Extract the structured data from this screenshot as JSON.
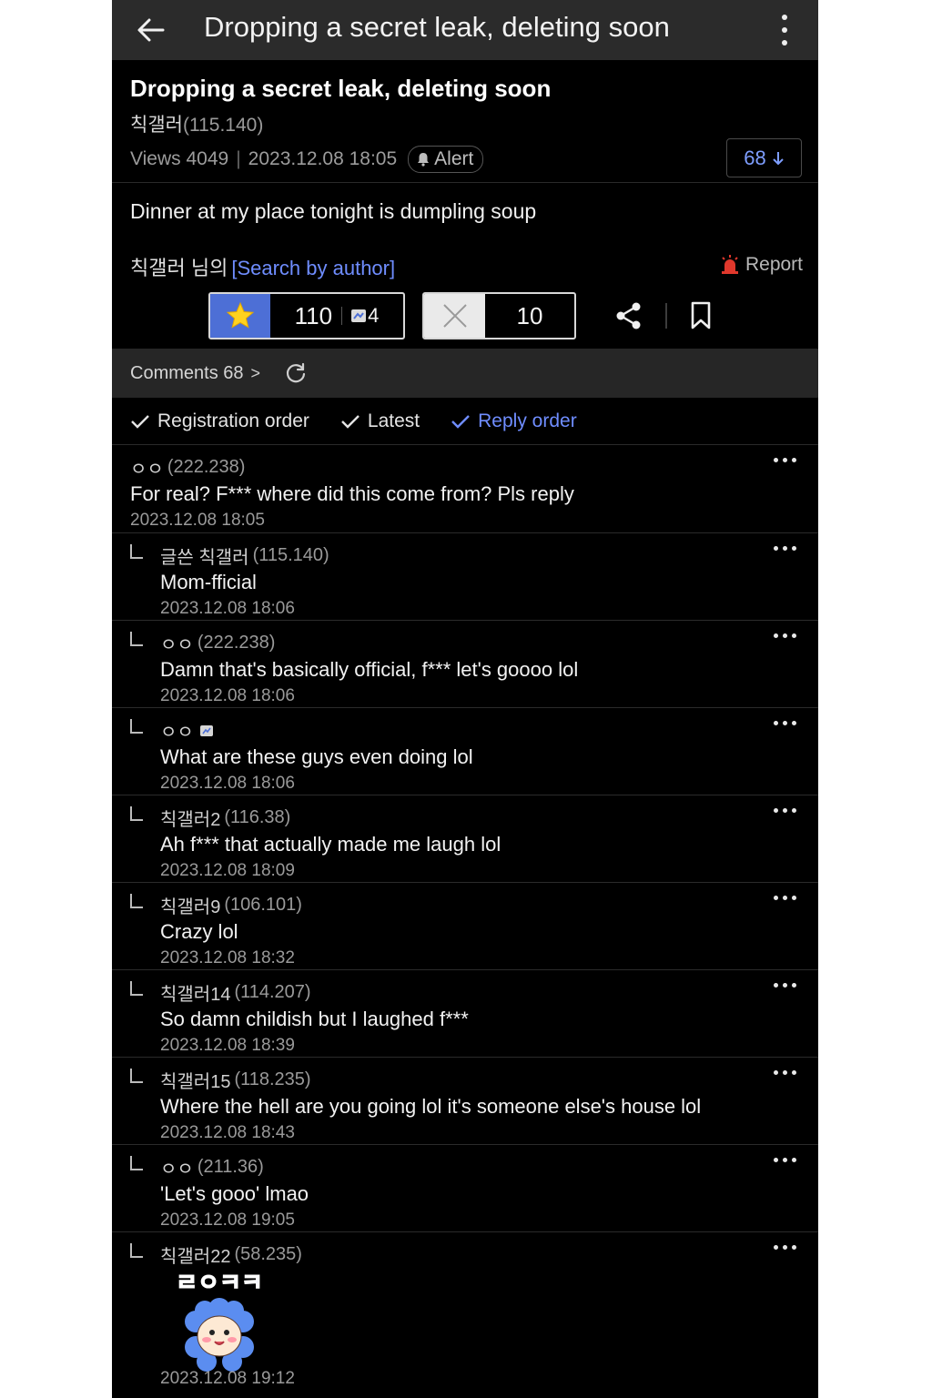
{
  "appbar": {
    "title": "Dropping a secret leak, deleting soon",
    "back_icon": "back-arrow-icon",
    "more_icon": "kebab-menu-icon"
  },
  "post": {
    "title": "Dropping a secret leak, deleting soon",
    "author": "칙갤러",
    "author_ip": "(115.140)",
    "views_label": "Views 4049",
    "datetime": "2023.12.08 18:05",
    "alert_label": "Alert",
    "comment_count_button": "68",
    "body": "Dinner at my place tonight is dumpling soup",
    "author_suffix": "칙갤러 님의",
    "search_by_author": "[Search by author]",
    "report_label": "Report",
    "upvotes": "110",
    "fixed_upvotes": "4",
    "downvotes": "10"
  },
  "comments_bar": {
    "label": "Comments 68",
    "chevron": ">"
  },
  "sort": {
    "options": [
      "Registration order",
      "Latest",
      "Reply order"
    ],
    "active": "Reply order"
  },
  "comments": [
    {
      "author": "ㅇㅇ",
      "ip": "(222.238)",
      "text": "For real? F*** where did this come from? Pls reply",
      "date": "2023.12.08 18:05"
    },
    {
      "author": "글쓴 칙갤러",
      "ip": "(115.140)",
      "text": "Mom-fficial",
      "date": "2023.12.08 18:06"
    },
    {
      "author": "ㅇㅇ",
      "ip": "(222.238)",
      "text": "Damn that's basically official, f*** let's goooo lol",
      "date": "2023.12.08 18:06"
    },
    {
      "author": "ㅇㅇ",
      "ip": "",
      "text": "What are these guys even doing lol",
      "date": "2023.12.08 18:06"
    },
    {
      "author": "칙갤러2",
      "ip": "(116.38)",
      "text": "Ah f*** that actually made me laugh lol",
      "date": "2023.12.08 18:09"
    },
    {
      "author": "칙갤러9",
      "ip": "(106.101)",
      "text": "Crazy lol",
      "date": "2023.12.08 18:32"
    },
    {
      "author": "칙갤러14",
      "ip": "(114.207)",
      "text": "So damn childish but I laughed f***",
      "date": "2023.12.08 18:39"
    },
    {
      "author": "칙갤러15",
      "ip": "(118.235)",
      "text": "Where the hell are you going lol it's someone else's house lol",
      "date": "2023.12.08 18:43"
    },
    {
      "author": "ㅇㅇ",
      "ip": "(211.36)",
      "text": "'Let's gooo' lmao",
      "date": "2023.12.08 19:05"
    },
    {
      "author": "칙갤러22",
      "ip": "(58.235)",
      "sticker_text": "ㄹㅇㅋㅋ",
      "date": "2023.12.08 19:12"
    }
  ],
  "colors": {
    "accent_blue": "#6f8dff",
    "upvote_blue": "#4d6fd6",
    "background": "#000000",
    "appbar": "#2b2b2b"
  }
}
